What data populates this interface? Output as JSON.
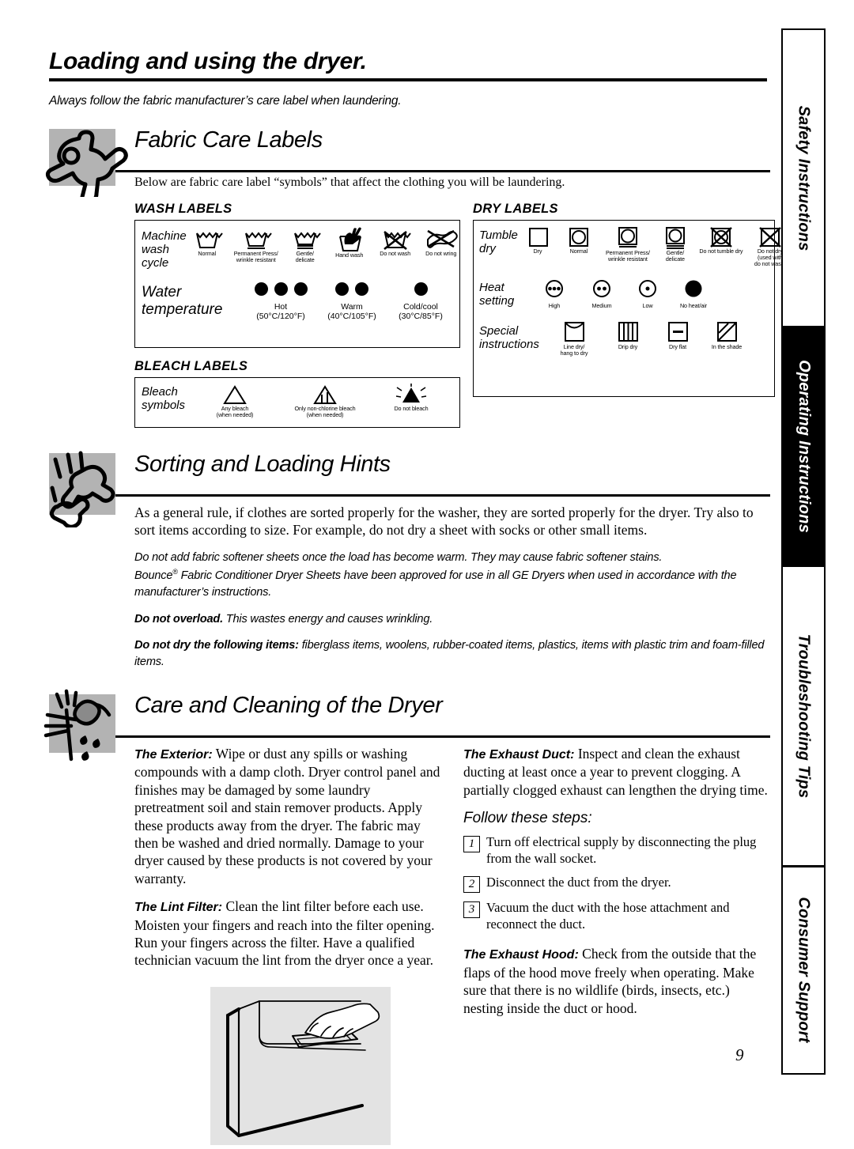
{
  "page": {
    "title": "Loading and using the dryer.",
    "intro": "Always follow the fabric manufacturer’s care label when laundering.",
    "number": "9"
  },
  "sections": {
    "fabric_care": {
      "title": "Fabric Care Labels",
      "intro": "Below are fabric care label “symbols” that affect the clothing you will be laundering.",
      "wash": {
        "heading": "WASH LABELS",
        "machine_row_label": "Machine\nwash\ncycle",
        "machine_symbols": [
          "Normal",
          "Permanent Press/\nwrinkle resistant",
          "Gentle/\ndelicate",
          "Hand wash",
          "Do not wash",
          "Do not wring"
        ],
        "water_row_label": "Water\ntemperature",
        "water_temps": [
          {
            "name": "Hot",
            "range": "(50°C/120°F)",
            "dots": 3
          },
          {
            "name": "Warm",
            "range": "(40°C/105°F)",
            "dots": 2
          },
          {
            "name": "Cold/cool",
            "range": "(30°C/85°F)",
            "dots": 1
          }
        ]
      },
      "bleach": {
        "heading": "BLEACH LABELS",
        "row_label": "Bleach\nsymbols",
        "symbols": [
          "Any bleach\n(when needed)",
          "Only non-chlorine bleach\n(when needed)",
          "Do not bleach"
        ]
      },
      "dry": {
        "heading": "DRY LABELS",
        "tumble_row_label": "Tumble\ndry",
        "tumble_symbols": [
          "Dry",
          "Normal",
          "Permanent Press/\nwrinkle resistant",
          "Gentle/\ndelicate",
          "Do not tumble dry",
          "Do not dry\n(used with\ndo not wash)"
        ],
        "heat_row_label": "Heat\nsetting",
        "heat_symbols": [
          "High",
          "Medium",
          "Low",
          "No heat/air"
        ],
        "special_row_label": "Special\ninstructions",
        "special_symbols": [
          "Line dry/\nhang to dry",
          "Drip dry",
          "Dry flat",
          "In the shade"
        ]
      }
    },
    "sorting": {
      "title": "Sorting and Loading Hints",
      "para1": "As a general rule, if clothes are sorted properly for the washer, they are sorted properly for the dryer. Try also to sort items according to size. For example, do not dry a sheet with socks or other small items.",
      "para2": "Do not add fabric softener sheets once the load has become warm. They may cause fabric softener stains.",
      "para3_pre": "Bounce",
      "para3_sup": "®",
      "para3": " Fabric Conditioner Dryer Sheets have been approved for use in all GE Dryers when used in accordance with the manufacturer’s instructions.",
      "para4_bold": "Do not overload.",
      "para4": " This wastes energy and causes wrinkling.",
      "para5_bold": "Do not dry the following items:",
      "para5": " fiberglass items, woolens, rubber-coated items, plastics, items with plastic trim and foam-filled items."
    },
    "care": {
      "title": "Care and Cleaning of the Dryer",
      "left": {
        "exterior_bold": "The Exterior:",
        "exterior": " Wipe or dust any spills or washing compounds with a damp cloth. Dryer control panel and finishes may be damaged by some laundry pretreatment soil and stain remover products. Apply these products away from the dryer. The fabric may then be washed and dried normally. Damage to your dryer caused by these products is not covered by your warranty.",
        "lint_bold": "The Lint Filter:",
        "lint": " Clean the lint filter before each use. Moisten your fingers and reach into the filter opening. Run your fingers across the filter. Have a qualified technician vacuum the lint from the dryer once a year."
      },
      "right": {
        "duct_bold": "The Exhaust Duct:",
        "duct": " Inspect and clean the exhaust ducting at least once a year to prevent clogging. A partially clogged exhaust can lengthen the drying time.",
        "steps_heading": "Follow these steps:",
        "steps": [
          {
            "n": "1",
            "text": "Turn off electrical supply by disconnecting the plug from the wall socket."
          },
          {
            "n": "2",
            "text": "Disconnect the duct from the dryer."
          },
          {
            "n": "3",
            "text": "Vacuum the duct with the hose attachment and reconnect the duct."
          }
        ],
        "hood_bold": "The Exhaust Hood:",
        "hood": " Check from the outside that the flaps of the hood move freely when operating. Make sure that there is no wildlife (birds, insects, etc.) nesting inside the duct or hood."
      }
    }
  },
  "rail": {
    "tabs": [
      {
        "label": "Safety Instructions",
        "active": false
      },
      {
        "label": "Operating Instructions",
        "active": true
      },
      {
        "label": "Troubleshooting Tips",
        "active": false
      },
      {
        "label": "Consumer Support",
        "active": false
      }
    ]
  },
  "colors": {
    "icon_bg": "#b3b3b3",
    "illustration_bg": "#e3e3e3",
    "ink": "#000000"
  }
}
